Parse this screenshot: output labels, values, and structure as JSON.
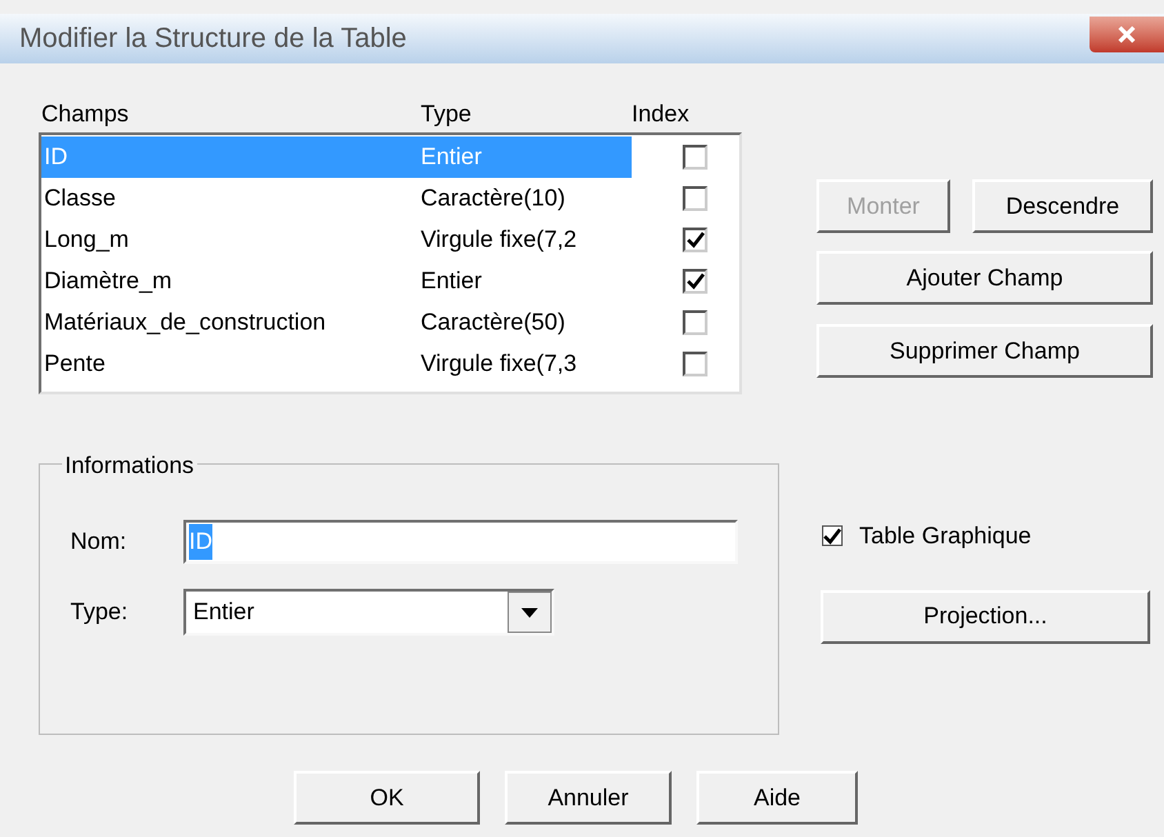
{
  "window": {
    "title": "Modifier la Structure de la Table"
  },
  "fields_list": {
    "columns": [
      "Champs",
      "Type",
      "Index"
    ],
    "rows": [
      {
        "name": "ID",
        "type": "Entier",
        "index": false,
        "selected": true
      },
      {
        "name": "Classe",
        "type": "Caractère(10)",
        "index": false,
        "selected": false
      },
      {
        "name": "Long_m",
        "type": "Virgule fixe(7,2",
        "index": true,
        "selected": false
      },
      {
        "name": "Diamètre_m",
        "type": "Entier",
        "index": true,
        "selected": false
      },
      {
        "name": "Matériaux_de_construction",
        "type": "Caractère(50)",
        "index": false,
        "selected": false
      },
      {
        "name": "Pente",
        "type": "Virgule fixe(7,3",
        "index": false,
        "selected": false
      }
    ]
  },
  "side_buttons": [
    {
      "label": "Monter",
      "disabled": true
    },
    {
      "label": "Descendre",
      "disabled": false
    },
    {
      "label": "Ajouter Champ",
      "disabled": false
    },
    {
      "label": "Supprimer Champ",
      "disabled": false
    }
  ],
  "informations": {
    "title": "Informations",
    "name_label": "Nom:",
    "name_value": "ID",
    "type_label": "Type:",
    "type_value": "Entier"
  },
  "graphic_table": {
    "label": "Table Graphique",
    "checked": true
  },
  "projection_button": "Projection...",
  "buttons": [
    "OK",
    "Annuler",
    "Aide"
  ]
}
